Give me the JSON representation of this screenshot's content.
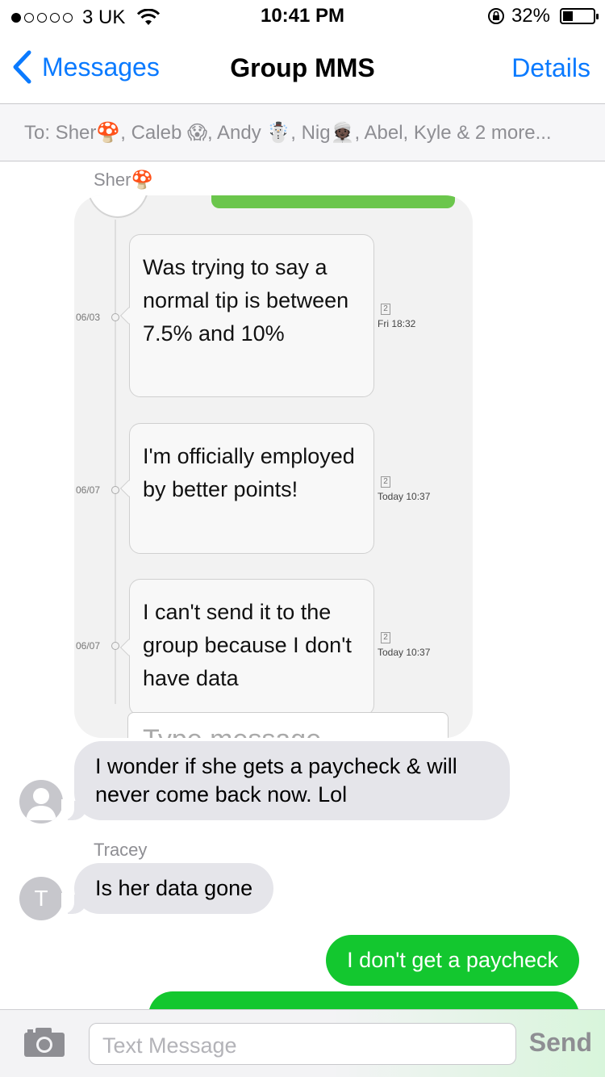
{
  "status": {
    "carrier": "3 UK",
    "time": "10:41 PM",
    "battery": "32%",
    "battery_level": 0.32,
    "signal_bars_filled": 1,
    "signal_bars_total": 5
  },
  "nav": {
    "back_label": "Messages",
    "title": "Group MMS",
    "details_label": "Details"
  },
  "recipients": "To: Sher🍄, Caleb 😱, Andy ☃️, Nig👳🏿, Abel, Kyle & 2 more...",
  "sender_top": "Sher🍄",
  "screenshot": {
    "cards": [
      {
        "date": "06/03",
        "text": "Was trying to say a normal tip is between 7.5% and 10%",
        "count": "2",
        "time": "Fri 18:32"
      },
      {
        "date": "06/07",
        "text": "I'm officially employed by better points!",
        "count": "2",
        "time": "Today 10:37"
      },
      {
        "date": "06/07",
        "text": "I can't send it to the group because I don't have data",
        "count": "2",
        "time": "Today 10:37"
      }
    ],
    "input_placeholder": "Type message"
  },
  "messages": {
    "m1": "I wonder if she gets a paycheck & will never come back now. Lol",
    "tracey_name": "Tracey",
    "tracey_initial": "T",
    "m2": "Is her data gone",
    "m3": "I don't get a paycheck"
  },
  "input": {
    "placeholder": "Text Message",
    "send_label": "Send"
  },
  "colors": {
    "ios_blue": "#0a7aff",
    "sms_green": "#13c72f",
    "incoming_gray": "#e5e5ea"
  }
}
